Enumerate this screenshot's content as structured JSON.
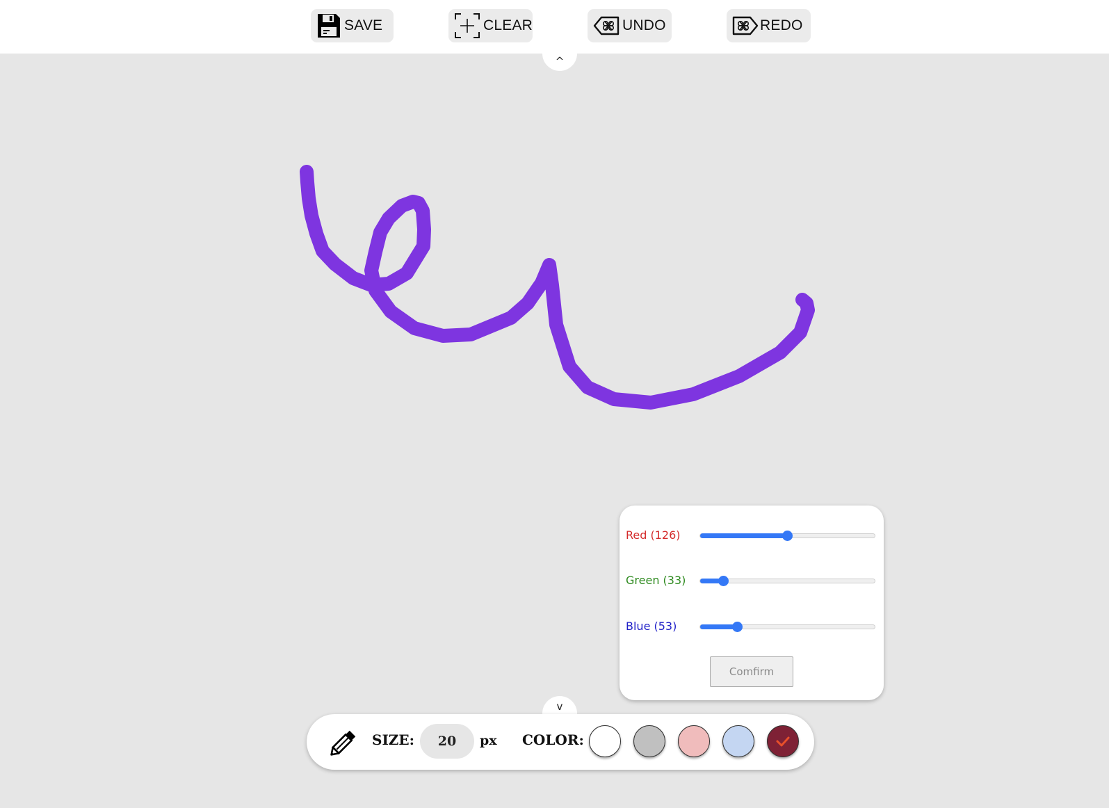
{
  "toolbar": {
    "save_label": "SAVE",
    "clear_label": "CLEAR",
    "undo_label": "UNDO",
    "redo_label": "REDO"
  },
  "toggles": {
    "top_glyph": "^",
    "bottom_glyph": "v"
  },
  "stroke": {
    "color": "#7e35e0"
  },
  "color_picker": {
    "red": {
      "label": "Red (126)",
      "value": 126,
      "color": "#d42b2b"
    },
    "green": {
      "label": "Green (33)",
      "value": 33,
      "color": "#2e8a1f"
    },
    "blue": {
      "label": "Blue (53)",
      "value": 53,
      "color": "#2222c8"
    },
    "max": 255,
    "slider_color": "#3478f6",
    "confirm_label": "Comfirm"
  },
  "bottom_bar": {
    "tool_icon": "pencil-icon",
    "size_label": "SIZE:",
    "size_value": "20",
    "size_unit": "px",
    "color_label": "COLOR:",
    "swatches": [
      {
        "name": "white",
        "color": "#ffffff",
        "selected": false
      },
      {
        "name": "gray",
        "color": "#c0c0c0",
        "selected": false
      },
      {
        "name": "pink",
        "color": "#f0bcbc",
        "selected": false
      },
      {
        "name": "light-blue",
        "color": "#c4d6f2",
        "selected": false
      },
      {
        "name": "custom",
        "color": "#7e2135",
        "selected": true
      }
    ],
    "check_color": "#e8502a"
  }
}
